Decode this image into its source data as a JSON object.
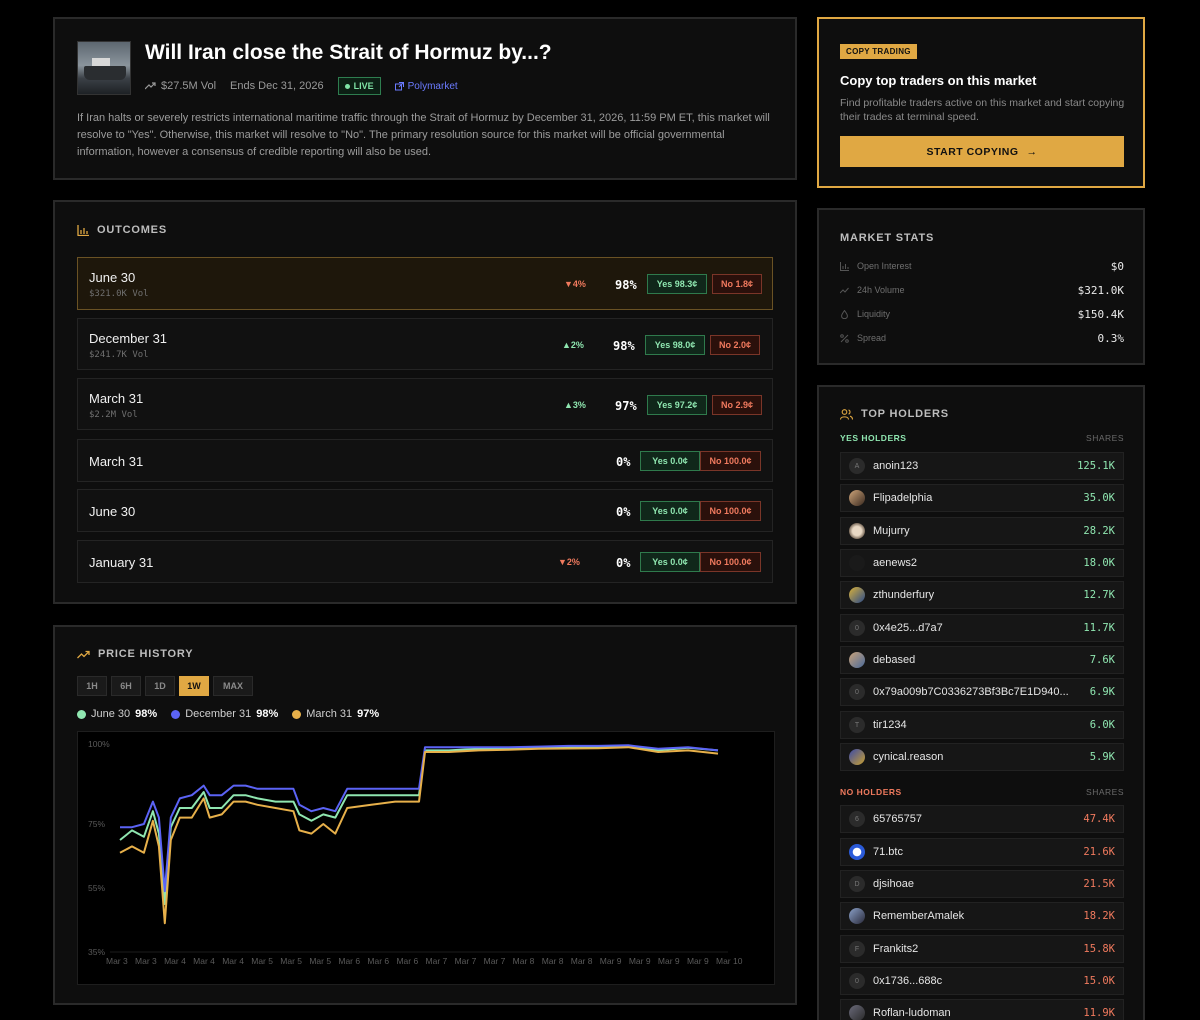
{
  "market": {
    "title": "Will Iran close the Strait of Hormuz by...?",
    "volume": "$27.5M Vol",
    "ends": "Ends Dec 31, 2026",
    "live": "LIVE",
    "source": "Polymarket",
    "description": "If Iran halts or severely restricts international maritime traffic through the Strait of Hormuz by December 31, 2026, 11:59 PM ET, this market will resolve to \"Yes\". Otherwise, this market will resolve to \"No\". The primary resolution source for this market will be official governmental information, however a consensus of credible reporting will also be used."
  },
  "copy": {
    "badge": "COPY TRADING",
    "title": "Copy top traders on this market",
    "subtitle": "Find profitable traders active on this market and start copying their trades at terminal speed.",
    "button": "START COPYING",
    "arrow": "→"
  },
  "outcomes": {
    "heading": "OUTCOMES",
    "rows": [
      {
        "name": "June 30",
        "vol": "$321.0K Vol",
        "change": "▼4%",
        "dir": "down",
        "pct": "98%",
        "yes": "Yes 98.3¢",
        "no": "No 1.8¢"
      },
      {
        "name": "December 31",
        "vol": "$241.7K Vol",
        "change": "▲2%",
        "dir": "up",
        "pct": "98%",
        "yes": "Yes 98.0¢",
        "no": "No 2.0¢"
      },
      {
        "name": "March 31",
        "vol": "$2.2M Vol",
        "change": "▲3%",
        "dir": "up",
        "pct": "97%",
        "yes": "Yes 97.2¢",
        "no": "No 2.9¢"
      },
      {
        "name": "March 31",
        "vol": "",
        "change": "",
        "dir": "",
        "pct": "0%",
        "yes": "Yes 0.0¢",
        "no": "No 100.0¢"
      },
      {
        "name": "June 30",
        "vol": "",
        "change": "",
        "dir": "",
        "pct": "0%",
        "yes": "Yes 0.0¢",
        "no": "No 100.0¢"
      },
      {
        "name": "January 31",
        "vol": "",
        "change": "▼2%",
        "dir": "down",
        "pct": "0%",
        "yes": "Yes 0.0¢",
        "no": "No 100.0¢"
      }
    ]
  },
  "stats": {
    "heading": "MARKET STATS",
    "rows": [
      {
        "label": "Open Interest",
        "value": "$0"
      },
      {
        "label": "24h Volume",
        "value": "$321.0K"
      },
      {
        "label": "Liquidity",
        "value": "$150.4K"
      },
      {
        "label": "Spread",
        "value": "0.3%"
      }
    ]
  },
  "holders": {
    "heading": "TOP HOLDERS",
    "yes_label": "YES HOLDERS",
    "no_label": "NO HOLDERS",
    "shares_label": "SHARES",
    "yes": [
      {
        "initial": "A",
        "name": "anoin123",
        "shares": "125.1K"
      },
      {
        "initial": "",
        "name": "Flipadelphia",
        "shares": "35.0K"
      },
      {
        "initial": "",
        "name": "Mujurry",
        "shares": "28.2K"
      },
      {
        "initial": "",
        "name": "aenews2",
        "shares": "18.0K"
      },
      {
        "initial": "",
        "name": "zthunderfury",
        "shares": "12.7K"
      },
      {
        "initial": "0",
        "name": "0x4e25...d7a7",
        "shares": "11.7K"
      },
      {
        "initial": "",
        "name": "debased",
        "shares": "7.6K"
      },
      {
        "initial": "0",
        "name": "0x79a009b7C0336273Bf3Bc7E1D940...",
        "shares": "6.9K"
      },
      {
        "initial": "T",
        "name": "tir1234",
        "shares": "6.0K"
      },
      {
        "initial": "",
        "name": "cynical.reason",
        "shares": "5.9K"
      }
    ],
    "no": [
      {
        "initial": "6",
        "name": "65765757",
        "shares": "47.4K"
      },
      {
        "initial": "",
        "name": "71.btc",
        "shares": "21.6K"
      },
      {
        "initial": "D",
        "name": "djsihoae",
        "shares": "21.5K"
      },
      {
        "initial": "",
        "name": "RememberAmalek",
        "shares": "18.2K"
      },
      {
        "initial": "F",
        "name": "Frankits2",
        "shares": "15.8K"
      },
      {
        "initial": "0",
        "name": "0x1736...688c",
        "shares": "15.0K"
      },
      {
        "initial": "",
        "name": "Roflan-ludoman",
        "shares": "11.9K"
      }
    ]
  },
  "price_history": {
    "heading": "PRICE HISTORY",
    "ranges": [
      "1H",
      "6H",
      "1D",
      "1W",
      "MAX"
    ],
    "active_range": "1W",
    "legend": [
      {
        "name": "June 30",
        "value": "98%",
        "color": "#8fe6b0"
      },
      {
        "name": "December 31",
        "value": "98%",
        "color": "#5b63f5"
      },
      {
        "name": "March 31",
        "value": "97%",
        "color": "#e7b04a"
      }
    ]
  },
  "chart_data": {
    "type": "line",
    "y_ticks": [
      "100%",
      "75%",
      "55%",
      "35%"
    ],
    "x_ticks": [
      "Mar 3",
      "Mar 3",
      "Mar 4",
      "Mar 4",
      "Mar 4",
      "Mar 5",
      "Mar 5",
      "Mar 5",
      "Mar 6",
      "Mar 6",
      "Mar 6",
      "Mar 7",
      "Mar 7",
      "Mar 7",
      "Mar 8",
      "Mar 8",
      "Mar 8",
      "Mar 9",
      "Mar 9",
      "Mar 9",
      "Mar 9",
      "Mar 10"
    ],
    "ylim": [
      35,
      100
    ],
    "grid": false,
    "series": [
      {
        "name": "June 30",
        "color": "#8fe6b0",
        "values": [
          [
            0,
            70
          ],
          [
            0.02,
            73
          ],
          [
            0.04,
            71
          ],
          [
            0.055,
            79
          ],
          [
            0.065,
            72
          ],
          [
            0.075,
            50
          ],
          [
            0.085,
            74
          ],
          [
            0.1,
            80
          ],
          [
            0.12,
            80
          ],
          [
            0.14,
            85
          ],
          [
            0.15,
            80
          ],
          [
            0.17,
            80
          ],
          [
            0.19,
            84
          ],
          [
            0.21,
            84
          ],
          [
            0.23,
            83
          ],
          [
            0.26,
            82
          ],
          [
            0.29,
            82
          ],
          [
            0.3,
            78
          ],
          [
            0.32,
            76
          ],
          [
            0.34,
            78
          ],
          [
            0.36,
            77
          ],
          [
            0.38,
            84
          ],
          [
            0.42,
            84
          ],
          [
            0.46,
            84
          ],
          [
            0.5,
            84
          ],
          [
            0.51,
            98
          ],
          [
            0.55,
            98
          ],
          [
            0.6,
            98.5
          ],
          [
            0.65,
            98.6
          ],
          [
            0.7,
            98.8
          ],
          [
            0.75,
            99
          ],
          [
            0.8,
            99
          ],
          [
            0.85,
            99.2
          ],
          [
            0.9,
            98
          ],
          [
            0.95,
            98.8
          ],
          [
            1,
            98
          ]
        ]
      },
      {
        "name": "December 31",
        "color": "#5b63f5",
        "values": [
          [
            0,
            74
          ],
          [
            0.02,
            74
          ],
          [
            0.04,
            75
          ],
          [
            0.055,
            82
          ],
          [
            0.065,
            77
          ],
          [
            0.075,
            54
          ],
          [
            0.085,
            77
          ],
          [
            0.1,
            83
          ],
          [
            0.12,
            84
          ],
          [
            0.14,
            87
          ],
          [
            0.15,
            84
          ],
          [
            0.17,
            84
          ],
          [
            0.19,
            87
          ],
          [
            0.21,
            87
          ],
          [
            0.23,
            86
          ],
          [
            0.26,
            86
          ],
          [
            0.29,
            86
          ],
          [
            0.3,
            81
          ],
          [
            0.32,
            79
          ],
          [
            0.34,
            80
          ],
          [
            0.36,
            79
          ],
          [
            0.38,
            86
          ],
          [
            0.42,
            86
          ],
          [
            0.46,
            86
          ],
          [
            0.5,
            86
          ],
          [
            0.51,
            99
          ],
          [
            0.55,
            99
          ],
          [
            0.6,
            99
          ],
          [
            0.65,
            99
          ],
          [
            0.7,
            99.2
          ],
          [
            0.75,
            99.4
          ],
          [
            0.8,
            99.4
          ],
          [
            0.85,
            99.6
          ],
          [
            0.9,
            98.5
          ],
          [
            0.95,
            99
          ],
          [
            1,
            98
          ]
        ]
      },
      {
        "name": "March 31",
        "color": "#e7b04a",
        "values": [
          [
            0,
            66
          ],
          [
            0.02,
            68
          ],
          [
            0.04,
            66
          ],
          [
            0.055,
            76
          ],
          [
            0.065,
            68
          ],
          [
            0.075,
            44
          ],
          [
            0.085,
            70
          ],
          [
            0.1,
            77
          ],
          [
            0.12,
            77
          ],
          [
            0.14,
            83
          ],
          [
            0.15,
            77
          ],
          [
            0.17,
            78
          ],
          [
            0.19,
            82
          ],
          [
            0.21,
            82
          ],
          [
            0.23,
            81
          ],
          [
            0.26,
            80
          ],
          [
            0.29,
            79
          ],
          [
            0.3,
            73
          ],
          [
            0.32,
            72
          ],
          [
            0.34,
            75
          ],
          [
            0.36,
            72
          ],
          [
            0.38,
            80
          ],
          [
            0.42,
            81
          ],
          [
            0.46,
            82
          ],
          [
            0.5,
            82
          ],
          [
            0.51,
            97.5
          ],
          [
            0.55,
            97.5
          ],
          [
            0.6,
            98
          ],
          [
            0.65,
            98.2
          ],
          [
            0.7,
            98.5
          ],
          [
            0.75,
            98.6
          ],
          [
            0.8,
            98.7
          ],
          [
            0.85,
            99
          ],
          [
            0.9,
            97.5
          ],
          [
            0.95,
            98
          ],
          [
            1,
            97
          ]
        ]
      }
    ]
  }
}
